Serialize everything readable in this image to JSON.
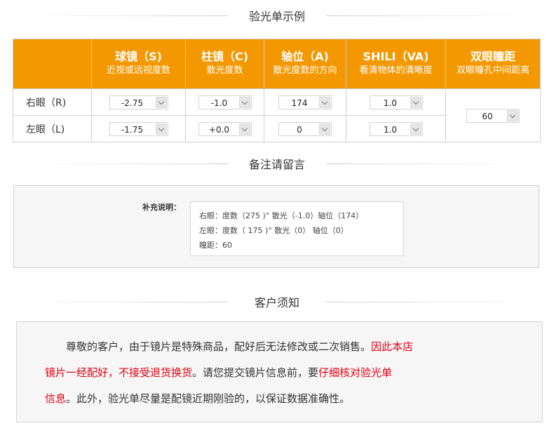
{
  "sections": {
    "prescription": "验光单示例",
    "notes": "备注请留言",
    "notice": "客户须知"
  },
  "table": {
    "headers": [
      {
        "title": "",
        "sub": ""
      },
      {
        "title": "球镜（S)",
        "sub": "近视或远视度数"
      },
      {
        "title": "柱镜（C)",
        "sub": "散光度数"
      },
      {
        "title": "轴位（A)",
        "sub": "散光度数的方向"
      },
      {
        "title": "SHILI（VA)",
        "sub": "看清物体的清晰度"
      },
      {
        "title": "双眼瞳距",
        "sub": "双眼瞳孔中间距离"
      }
    ],
    "rows": [
      {
        "eye": "右眼（R)",
        "sphere": "-2.75",
        "cylinder": "-1.0",
        "axis": "174",
        "va": "1.0"
      },
      {
        "eye": "左眼（L)",
        "sphere": "-1.75",
        "cylinder": "+0.0",
        "axis": "0",
        "va": "1.0"
      }
    ],
    "pd": "60"
  },
  "notes": {
    "label": "补充说明：",
    "lines": [
      "右眼：度数（275 )° 散光（-1.0）轴位（174）",
      "左眼：度数（ 175 )° 散光（0）    轴位（0）",
      "瞳距：60"
    ]
  },
  "notice": {
    "line1_normal": "尊敬的客户，由于镜片是特殊商品，配好后无法修改或二次销售。",
    "line1_red": "因此本店",
    "line2_red1": "镜片一经配好，不接受退货换货",
    "line2_normal": "。请您提交镜片信息前，要",
    "line2_red2": "仔细核对验光单",
    "line3_red": "信息",
    "line3_normal": "。此外，验光单尽量是配镜近期刚验的，以保证数据准确性。"
  },
  "colors": {
    "header_bg": "#f39800",
    "highlight": "#e60012"
  }
}
